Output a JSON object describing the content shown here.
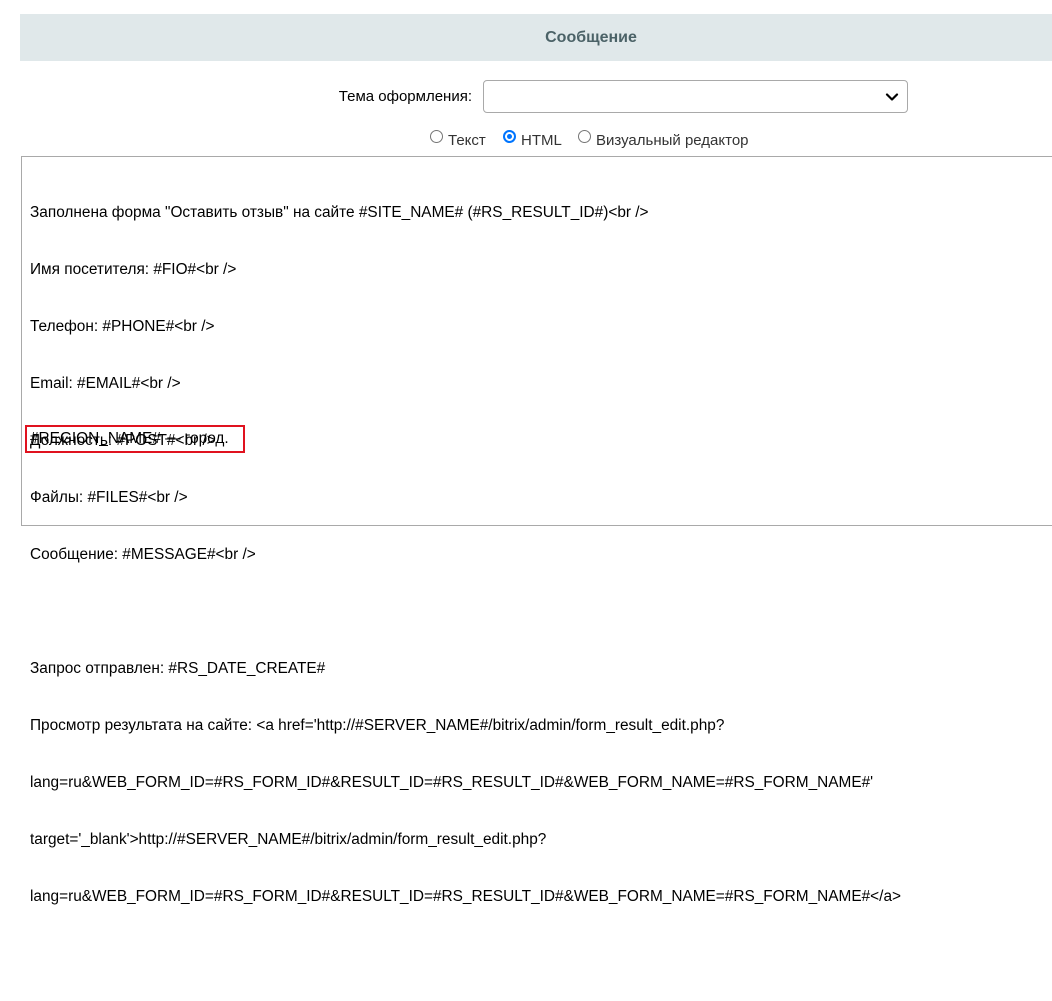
{
  "header": {
    "title": "Сообщение"
  },
  "theme": {
    "label": "Тема оформления:",
    "selected": ""
  },
  "modes": [
    {
      "label": "Текст",
      "checked": false
    },
    {
      "label": "HTML",
      "checked": true
    },
    {
      "label": "Визуальный редактор",
      "checked": false
    }
  ],
  "editor": {
    "lines": [
      "Заполнена форма \"Оставить отзыв\" на сайте #SITE_NAME# (#RS_RESULT_ID#)<br />",
      "Имя посетителя: #FIO#<br />",
      "Телефон: #PHONE#<br />",
      "Email: #EMAIL#<br />",
      "Должность: #POST#<br />",
      "Файлы: #FILES#<br />",
      "Сообщение: #MESSAGE#<br />",
      "",
      "Запрос отправлен: #RS_DATE_CREATE#",
      "Просмотр результата на сайте: <a href='http://#SERVER_NAME#/bitrix/admin/form_result_edit.php?",
      "lang=ru&WEB_FORM_ID=#RS_FORM_ID#&RESULT_ID=#RS_RESULT_ID#&WEB_FORM_NAME=#RS_FORM_NAME#'",
      "target='_blank'>http://#SERVER_NAME#/bitrix/admin/form_result_edit.php?",
      "lang=ru&WEB_FORM_ID=#RS_FORM_ID#&RESULT_ID=#RS_RESULT_ID#&WEB_FORM_NAME=#RS_FORM_NAME#</a>",
      ""
    ],
    "highlighted_line": "#REGION_NAME# — город.",
    "highlight_color": "#e0121f"
  }
}
